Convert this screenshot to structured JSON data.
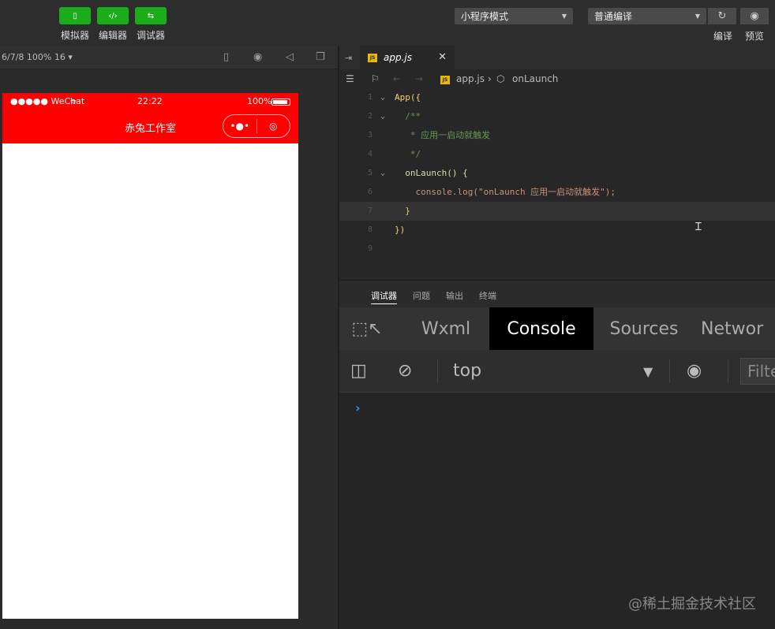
{
  "toolbar": {
    "tools": [
      {
        "label": "模拟器",
        "icon": "phone-icon"
      },
      {
        "label": "编辑器",
        "icon": "code-icon"
      },
      {
        "label": "调试器",
        "icon": "debug-icon"
      }
    ],
    "mode_select": "小程序模式",
    "compile_select": "普通编译",
    "compile_label": "编译",
    "preview_label": "预览"
  },
  "simulator": {
    "zoom": "6/7/8 100% 16",
    "status": {
      "signal": "●●●●● WeChat",
      "time": "22:22",
      "battery": "100%"
    },
    "nav_title": "赤兔工作室",
    "nav_color": "#ff0000"
  },
  "editor": {
    "tab": "app.js",
    "breadcrumb": {
      "file": "app.js",
      "symbol": "onLaunch"
    },
    "lines": [
      {
        "num": "1",
        "text": "App({"
      },
      {
        "num": "2",
        "text": "  /**"
      },
      {
        "num": "3",
        "text": "   * 应用一启动就触发"
      },
      {
        "num": "4",
        "text": "   */"
      },
      {
        "num": "5",
        "text": "  onLaunch() {"
      },
      {
        "num": "6",
        "text": "    console.log(\"onLaunch 应用一启动就触发\");"
      },
      {
        "num": "7",
        "text": "  }"
      },
      {
        "num": "8",
        "text": "})"
      },
      {
        "num": "9",
        "text": ""
      }
    ]
  },
  "debugger": {
    "tabs": [
      "调试器",
      "问题",
      "输出",
      "终端"
    ],
    "devtools_tabs": [
      "Wxml",
      "Console",
      "Sources",
      "Networ"
    ],
    "context": "top",
    "filter_placeholder": "Filte",
    "prompt": "›"
  },
  "watermark": "@稀土掘金技术社区"
}
